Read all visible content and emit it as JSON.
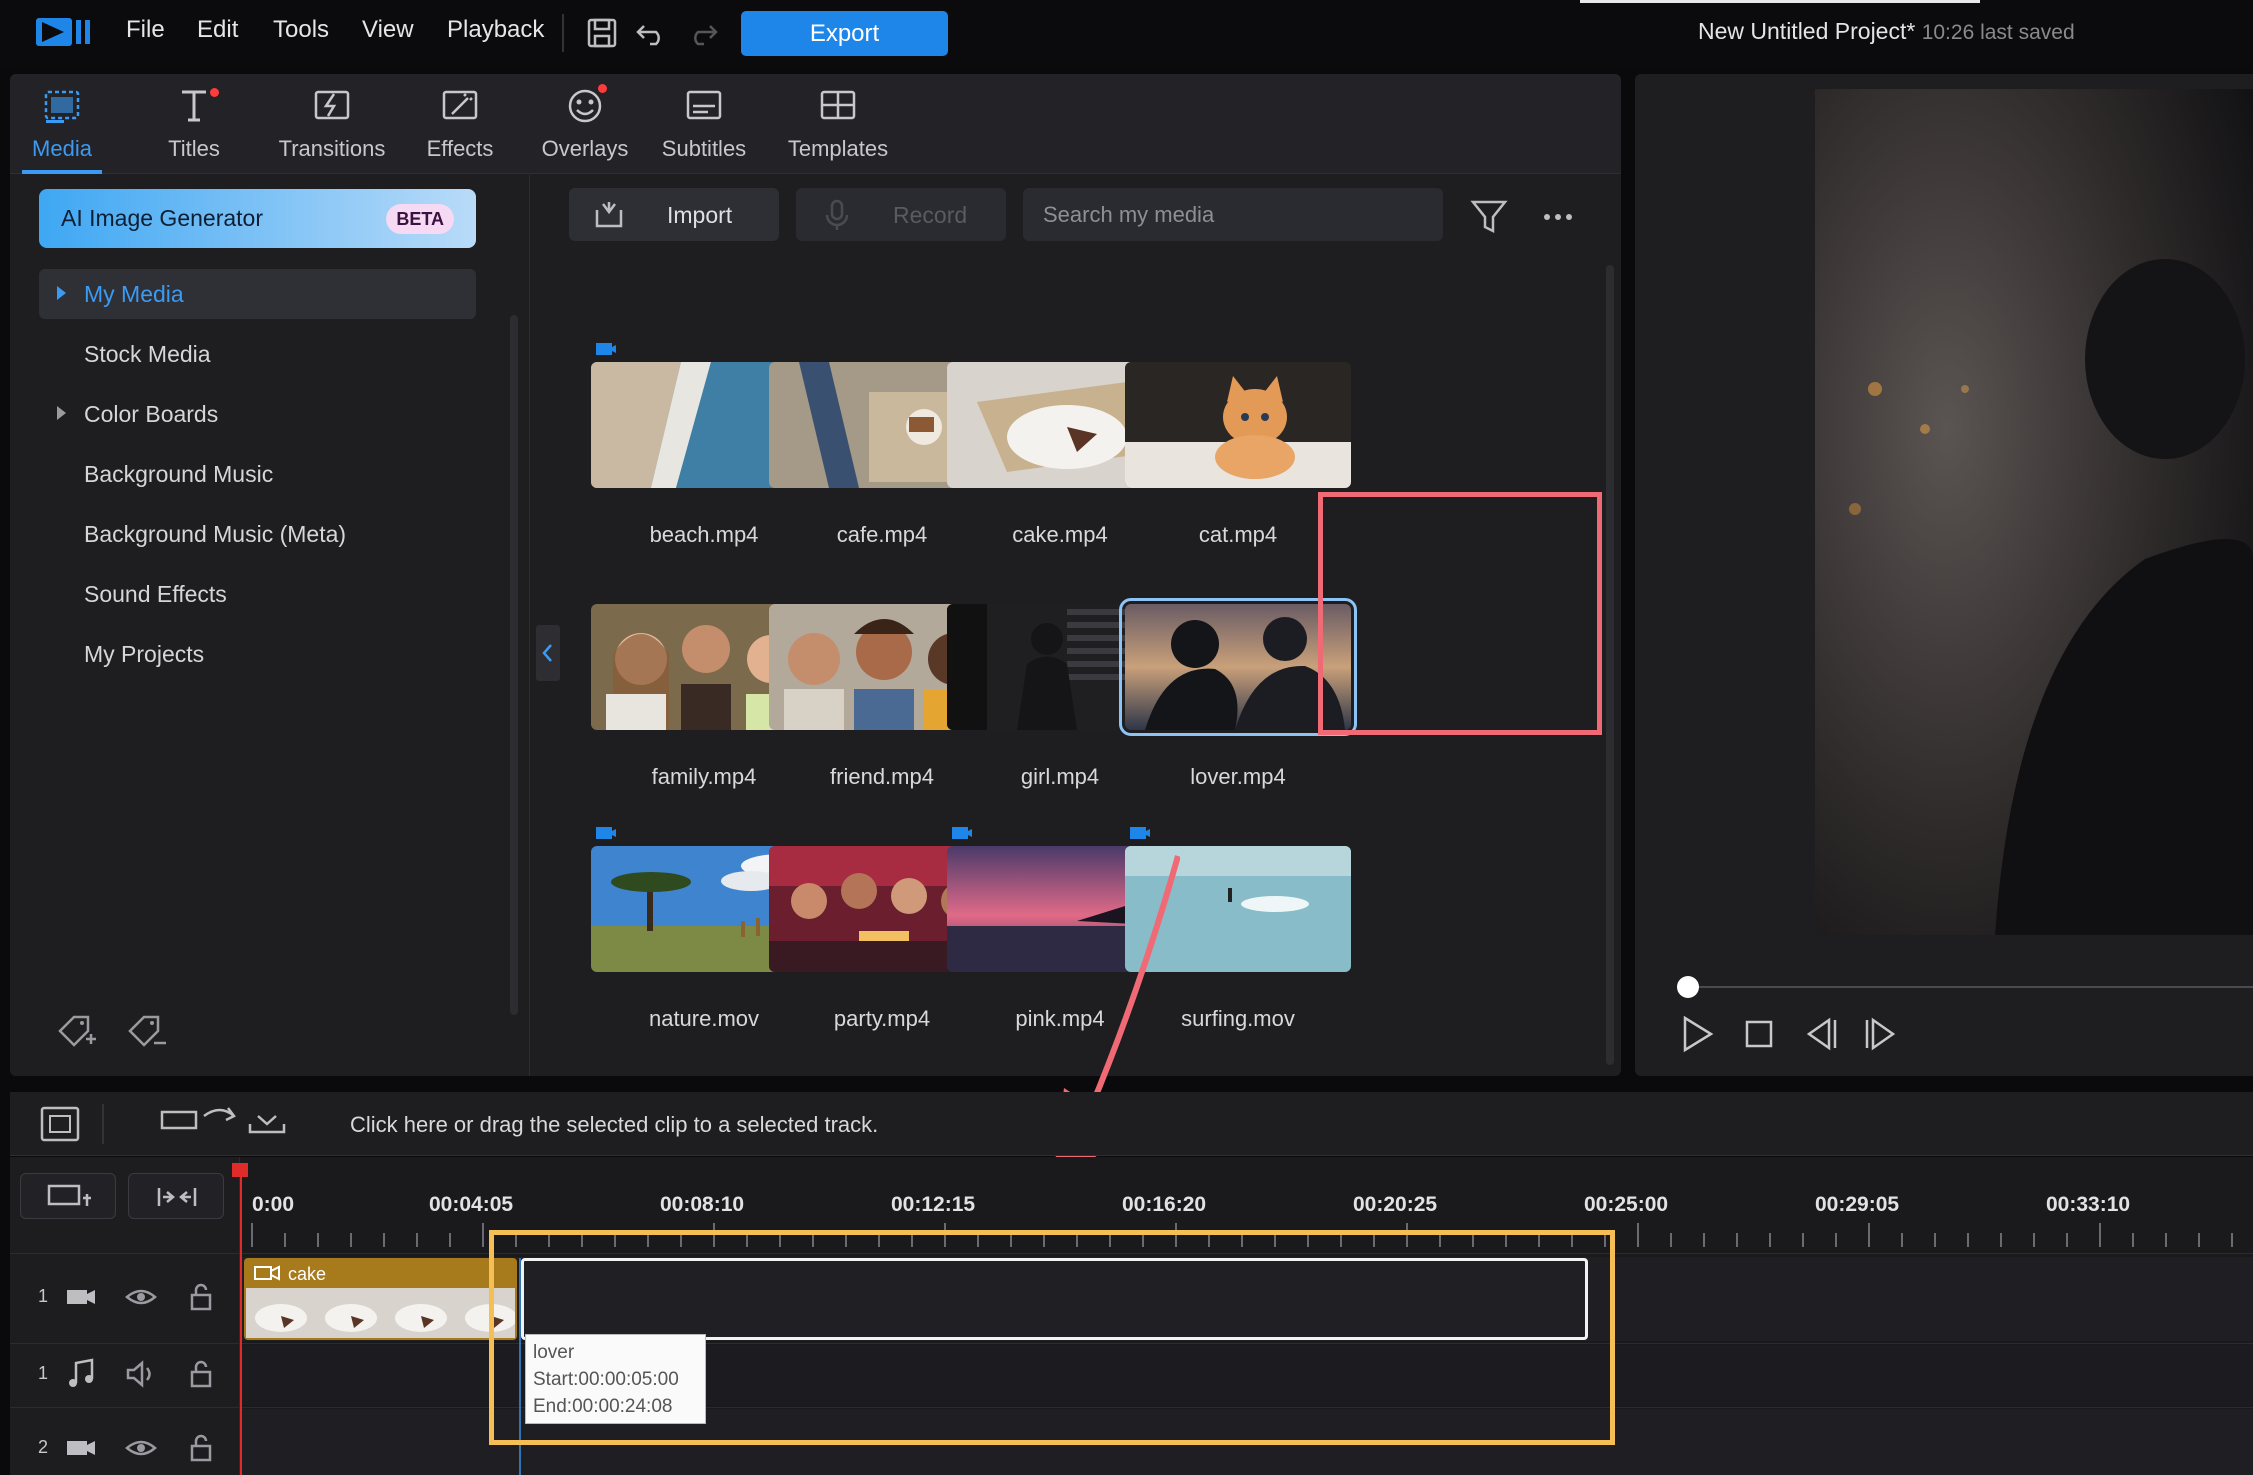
{
  "menu": {
    "items": [
      "File",
      "Edit",
      "Tools",
      "View",
      "Playback"
    ],
    "export_label": "Export",
    "project_title": "New Untitled Project*",
    "project_saved": "10:26 last saved"
  },
  "tabs": [
    {
      "label": "Media",
      "icon": "media-icon",
      "active": true
    },
    {
      "label": "Titles",
      "icon": "titles-icon",
      "dot": true
    },
    {
      "label": "Transitions",
      "icon": "transitions-icon"
    },
    {
      "label": "Effects",
      "icon": "effects-icon"
    },
    {
      "label": "Overlays",
      "icon": "overlays-icon",
      "dot": true
    },
    {
      "label": "Subtitles",
      "icon": "subtitles-icon"
    },
    {
      "label": "Templates",
      "icon": "templates-icon"
    }
  ],
  "sidebar": {
    "ai_button": "AI Image Generator",
    "ai_badge": "BETA",
    "items": [
      {
        "label": "My Media",
        "selected": true,
        "expandable": true
      },
      {
        "label": "Stock Media"
      },
      {
        "label": "Color Boards",
        "expandable": true
      },
      {
        "label": "Background Music"
      },
      {
        "label": "Background Music (Meta)"
      },
      {
        "label": "Sound Effects"
      },
      {
        "label": "My Projects"
      }
    ]
  },
  "content": {
    "import_label": "Import",
    "record_label": "Record",
    "search_placeholder": "Search my media",
    "media": [
      {
        "name": "beach.mp4"
      },
      {
        "name": "cafe.mp4"
      },
      {
        "name": "cake.mp4",
        "checked": true
      },
      {
        "name": "cat.mp4"
      },
      {
        "name": "family.mp4"
      },
      {
        "name": "friend.mp4"
      },
      {
        "name": "girl.mp4"
      },
      {
        "name": "lover.mp4",
        "selected": true
      },
      {
        "name": "nature.mov"
      },
      {
        "name": "party.mp4"
      },
      {
        "name": "pink.mp4"
      },
      {
        "name": "surfing.mov"
      }
    ]
  },
  "timeline": {
    "hint": "Click here or drag the selected clip to a selected track.",
    "ticks": [
      "0:00",
      "00:04:05",
      "00:08:10",
      "00:12:15",
      "00:16:20",
      "00:20:25",
      "00:25:00",
      "00:29:05",
      "00:33:10"
    ],
    "tracks": [
      {
        "num": "1",
        "type": "video"
      },
      {
        "num": "1",
        "type": "audio"
      },
      {
        "num": "2",
        "type": "video"
      }
    ],
    "clip_label": "cake",
    "tooltip": {
      "name": "lover",
      "start": "Start:00:00:05:00",
      "end": "End:00:00:24:08"
    }
  },
  "colors": {
    "accent": "#3b9af2",
    "export": "#1d86e8",
    "highlight_red": "#f06a75",
    "highlight_yellow": "#f5bf55"
  }
}
